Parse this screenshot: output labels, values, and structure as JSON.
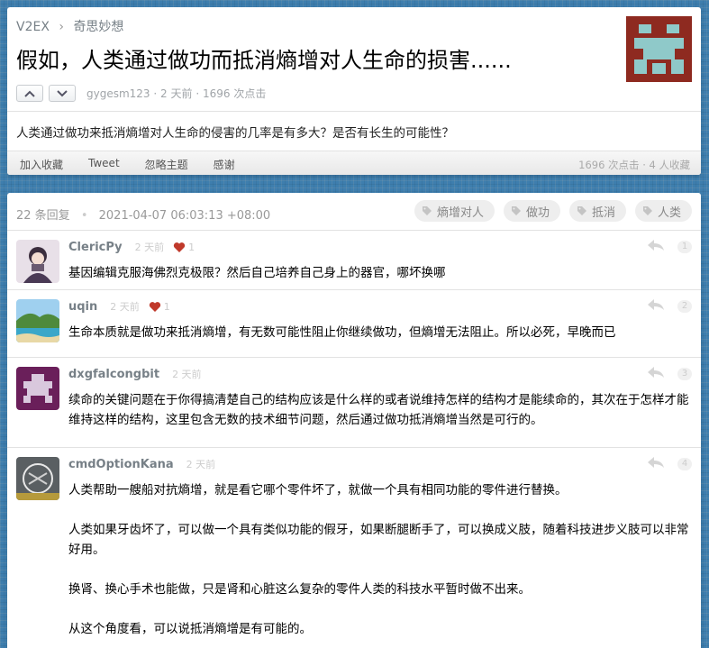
{
  "breadcrumb": {
    "site": "V2EX",
    "separator": "›",
    "node": "奇思妙想"
  },
  "topic": {
    "title": "假如，人类通过做功而抵消熵增对人生命的损害......",
    "author": "gygesm123",
    "time": "2 天前",
    "clicks": "1696 次点击",
    "content": "人类通过做功来抵消熵增对人生命的侵害的几率是有多大？是否有长生的可能性？",
    "actions": [
      "加入收藏",
      "Tweet",
      "忽略主题",
      "感谢"
    ],
    "stats": "1696 次点击 · 4 人收藏"
  },
  "replies_header": {
    "count": "22 条回复",
    "separator": "•",
    "date": "2021-04-07 06:03:13 +08:00",
    "tags": [
      "熵增对人",
      "做功",
      "抵消",
      "人类"
    ]
  },
  "replies": [
    {
      "user": "ClericPy",
      "time": "2 天前",
      "thanks": "1",
      "floor": "1",
      "content": [
        "基因编辑克服海佛烈克极限？然后自己培养自己身上的器官，哪坏换哪"
      ]
    },
    {
      "user": "uqin",
      "time": "2 天前",
      "thanks": "1",
      "floor": "2",
      "content": [
        "生命本质就是做功来抵消熵增，有无数可能性阻止你继续做功，但熵增无法阻止。所以必死，早晚而已"
      ]
    },
    {
      "user": "dxgfalcongbit",
      "time": "2 天前",
      "floor": "3",
      "content": [
        "续命的关键问题在于你得搞清楚自己的结构应该是什么样的或者说维持怎样的结构才是能续命的，其次在于怎样才能维持这样的结构，这里包含无数的技术细节问题，然后通过做功抵消熵增当然是可行的。"
      ]
    },
    {
      "user": "cmdOptionKana",
      "time": "2 天前",
      "floor": "4",
      "content": [
        "人类帮助一艘船对抗熵增，就是看它哪个零件坏了，就做一个具有相同功能的零件进行替换。",
        "人类如果牙齿坏了，可以做一个具有类似功能的假牙，如果断腿断手了，可以换成义肢，随着科技进步义肢可以非常好用。",
        "换肾、换心手术也能做，只是肾和心脏这么复杂的零件人类的科技水平暂时做不出来。",
        "从这个角度看，可以说抵消熵增是有可能的。"
      ]
    }
  ],
  "colors": {
    "background": "#3e7eae",
    "link_gray": "#778087",
    "heart": "#c0392b",
    "op_avatar_bg": "#8e2a20",
    "op_avatar_fg": "#8fc9c9"
  },
  "icons": {
    "vote_up": "chevron-up-icon",
    "vote_down": "chevron-down-icon",
    "tag": "tag-icon",
    "reply": "reply-arrow-icon",
    "thanks": "heart-icon"
  }
}
